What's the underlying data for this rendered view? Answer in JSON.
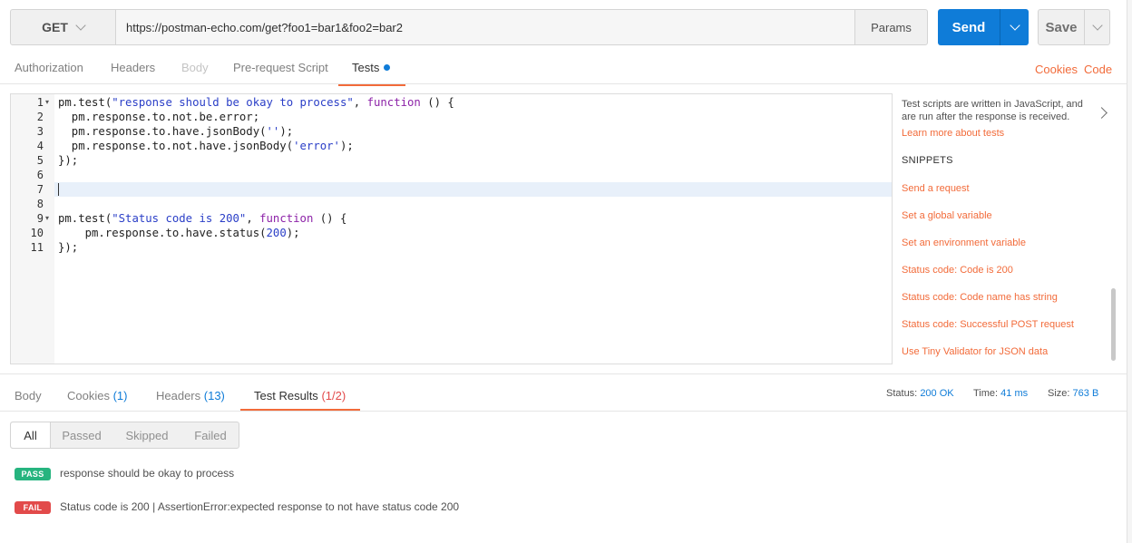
{
  "request": {
    "method": "GET",
    "url": "https://postman-echo.com/get?foo1=bar1&foo2=bar2",
    "params_label": "Params",
    "send_label": "Send",
    "save_label": "Save"
  },
  "request_tabs": {
    "authorization": "Authorization",
    "headers": "Headers",
    "body": "Body",
    "prerequest": "Pre-request Script",
    "tests": "Tests",
    "cookies": "Cookies",
    "code": "Code"
  },
  "editor": {
    "line_numbers": [
      "1",
      "2",
      "3",
      "4",
      "5",
      "6",
      "7",
      "8",
      "9",
      "10",
      "11"
    ],
    "active_line": 7
  },
  "side_panel": {
    "description": "Test scripts are written in JavaScript, and are run after the response is received.",
    "learn_more": "Learn more about tests",
    "snippets_heading": "SNIPPETS",
    "snippets": [
      "Send a request",
      "Set a global variable",
      "Set an environment variable",
      "Status code: Code is 200",
      "Status code: Code name has string",
      "Status code: Successful POST request",
      "Use Tiny Validator for JSON data"
    ]
  },
  "response_tabs": {
    "body": "Body",
    "cookies": "Cookies",
    "cookies_count": "(1)",
    "headers": "Headers",
    "headers_count": "(13)",
    "test_results": "Test Results",
    "test_results_count": "(1/2)"
  },
  "response_meta": {
    "status_label": "Status:",
    "status_value": "200 OK",
    "time_label": "Time:",
    "time_value": "41 ms",
    "size_label": "Size:",
    "size_value": "763 B"
  },
  "filters": {
    "all": "All",
    "passed": "Passed",
    "skipped": "Skipped",
    "failed": "Failed"
  },
  "results": [
    {
      "badge": "PASS",
      "text": "response should be okay to process",
      "color": "#26b47f"
    },
    {
      "badge": "FAIL",
      "text": "Status code is 200 | AssertionError:expected response to not have status code 200",
      "color": "#e24a4a"
    }
  ],
  "colors": {
    "accent": "#f26b3a",
    "primary": "#0f7cd8"
  }
}
